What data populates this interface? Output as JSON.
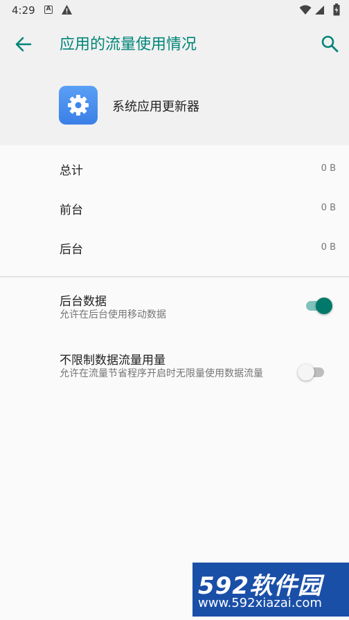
{
  "status_bar": {
    "time": "4:29",
    "icons": [
      "a-notification-icon",
      "warning-icon",
      "wifi-icon",
      "signal-icon",
      "battery-icon"
    ]
  },
  "header": {
    "title": "应用的流量使用情况",
    "app_name": "系统应用更新器",
    "accent_color": "#008577"
  },
  "usage": {
    "rows": [
      {
        "label": "总计",
        "value": "0 B"
      },
      {
        "label": "前台",
        "value": "0 B"
      },
      {
        "label": "后台",
        "value": "0 B"
      }
    ]
  },
  "prefs": {
    "background_data": {
      "title": "后台数据",
      "summary": "允许在后台使用移动数据",
      "enabled": true
    },
    "unrestricted_data": {
      "title": "不限制数据流量用量",
      "summary": "允许在流量节省程序开启时无限量使用数据流量",
      "enabled": false
    }
  },
  "watermark": {
    "brand": "592软件园",
    "url": "www.592xiazai.com"
  }
}
